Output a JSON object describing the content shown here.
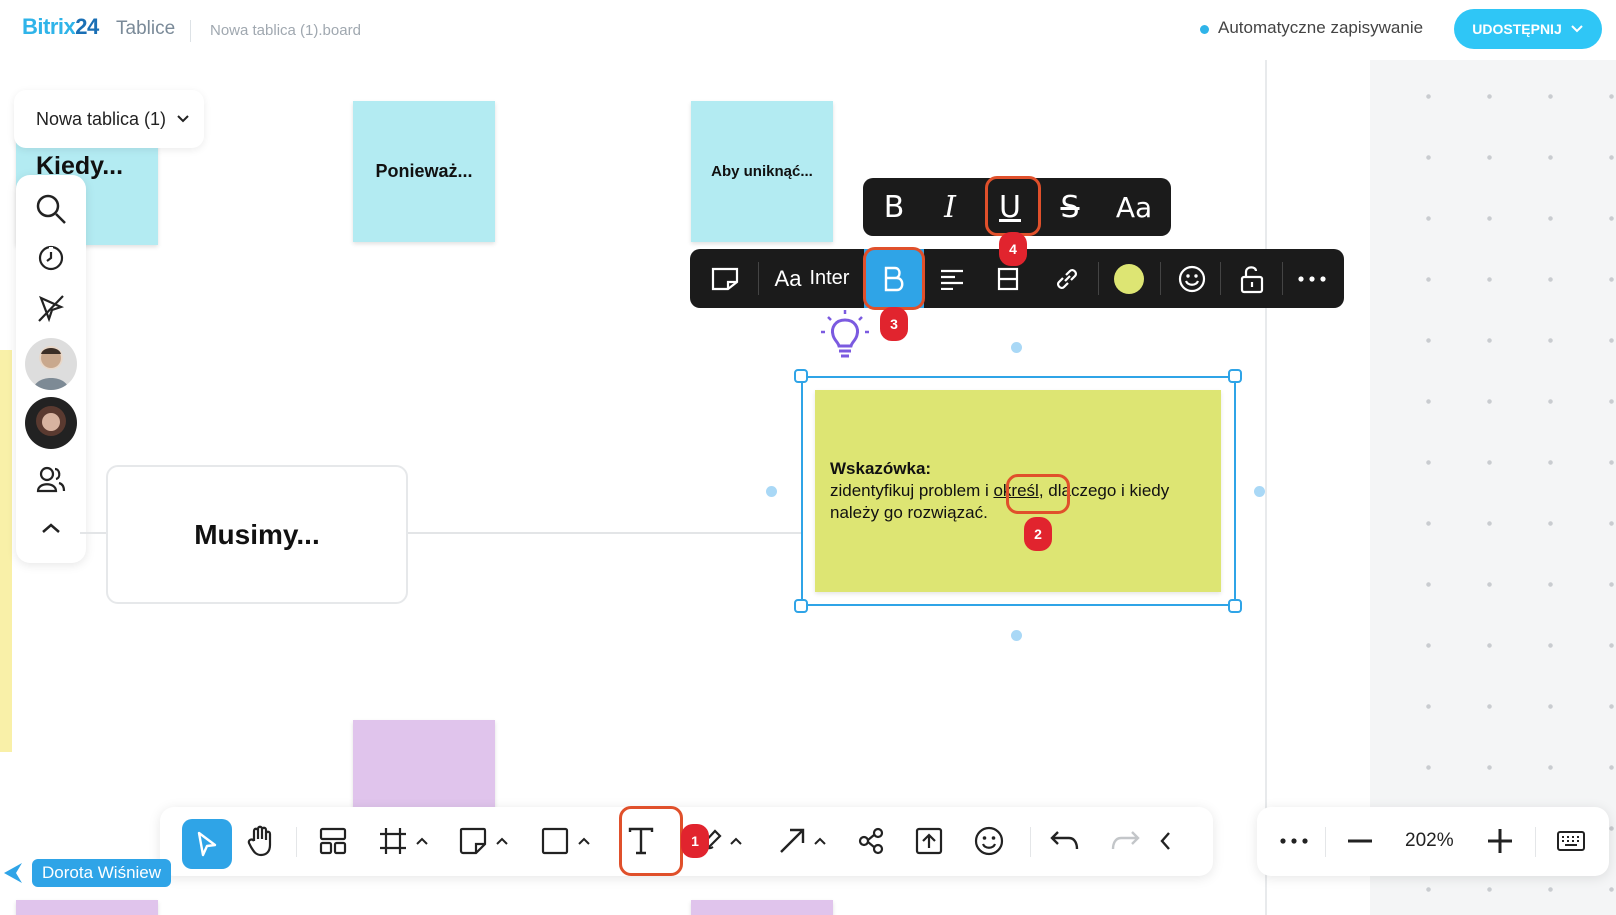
{
  "header": {
    "logo_brand": "Bitrix",
    "logo_num": "24",
    "logo_sub": "Tablice",
    "file_name": "Nowa tablica (1).board",
    "autosave": "Automatyczne zapisywanie",
    "share_label": "UDOSTĘPNIJ"
  },
  "board": {
    "name": "Nowa tablica (1)"
  },
  "stickies": {
    "kiedy": "Kiedy...",
    "poniewaz": "Ponieważ...",
    "aby": "Aby uniknąć...",
    "musimy": "Musimy..."
  },
  "note": {
    "title": "Wskazówka:",
    "line1_a": "zidentyfikuj problem i ",
    "line1_u": "określ",
    "line1_b": ", dlaczego i kiedy",
    "line2": "należy go rozwiązać."
  },
  "toolbar": {
    "font_prefix": "Aa",
    "font_name": "Inter",
    "note_color": "#dde573"
  },
  "format_bar": {
    "bold": "B",
    "italic": "I",
    "underline": "U",
    "strike": "S",
    "case": "Aa"
  },
  "badges": [
    "1",
    "2",
    "3",
    "4"
  ],
  "zoom": {
    "value": "202%"
  },
  "cursor_user": "Dorota Wiśniew",
  "colors": {
    "accent": "#2fa4e7",
    "highlight": "#e0502b",
    "badge": "#e1242e"
  }
}
